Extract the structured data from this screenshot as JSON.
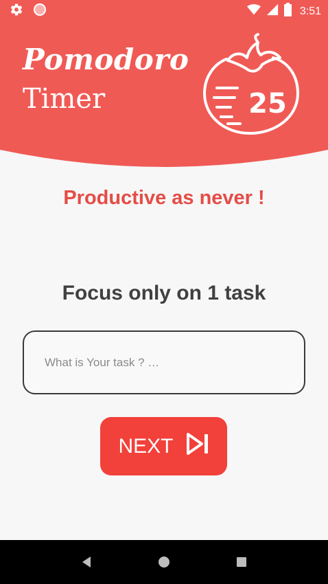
{
  "status_bar": {
    "time": "3:51",
    "left_icons": [
      "settings-icon",
      "record-dot-icon"
    ],
    "right_icons": [
      "wifi-icon",
      "signal-icon",
      "battery-icon"
    ]
  },
  "header": {
    "title_line1": "Pomodoro",
    "title_line2": "Timer",
    "logo_number": "25",
    "background_color": "#f05a55"
  },
  "main": {
    "tagline": "Productive as never !",
    "focus_title": "Focus only on 1 task",
    "task_input": {
      "value": "",
      "placeholder": "What is Your task ? …"
    },
    "next_button": {
      "label": "NEXT",
      "icon": "skip-next-icon",
      "color": "#f2403a"
    }
  },
  "nav_bar": {
    "icons": [
      "back-icon",
      "home-icon",
      "recents-icon"
    ]
  }
}
